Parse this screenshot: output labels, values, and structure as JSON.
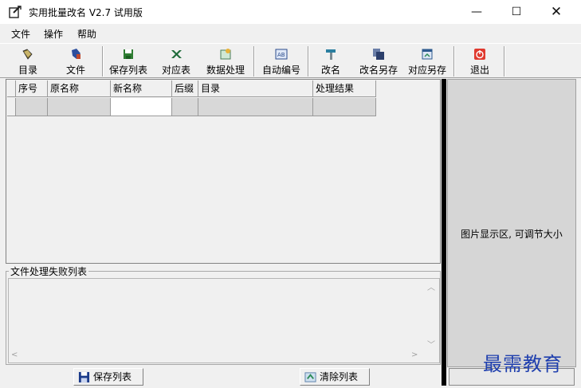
{
  "window": {
    "title": "实用批量改名 V2.7 试用版",
    "controls": {
      "minimize": "—",
      "maximize": "☐",
      "close": "✕"
    }
  },
  "menu": [
    "文件",
    "操作",
    "帮助"
  ],
  "toolbar": {
    "dir": "目录",
    "file": "文件",
    "save_list": "保存列表",
    "mapping": "对应表",
    "data_process": "数据处理",
    "auto_number": "自动编号",
    "rename": "改名",
    "rename_save_as": "改名另存",
    "mapping_save_as": "对应另存",
    "exit": "退出"
  },
  "table": {
    "columns": [
      "序号",
      "原名称",
      "新名称",
      "后缀",
      "目录",
      "处理结果"
    ]
  },
  "image_area": {
    "label": "图片显示区, 可调节大小"
  },
  "fail_list": {
    "title": "文件处理失败列表"
  },
  "bottom": {
    "save_list": "保存列表",
    "clear_list": "清除列表"
  },
  "watermark": "最需教育",
  "colors": {
    "watermark": "#1f3fae",
    "splitter": "#000000",
    "exit_icon": "#e03a2f"
  }
}
